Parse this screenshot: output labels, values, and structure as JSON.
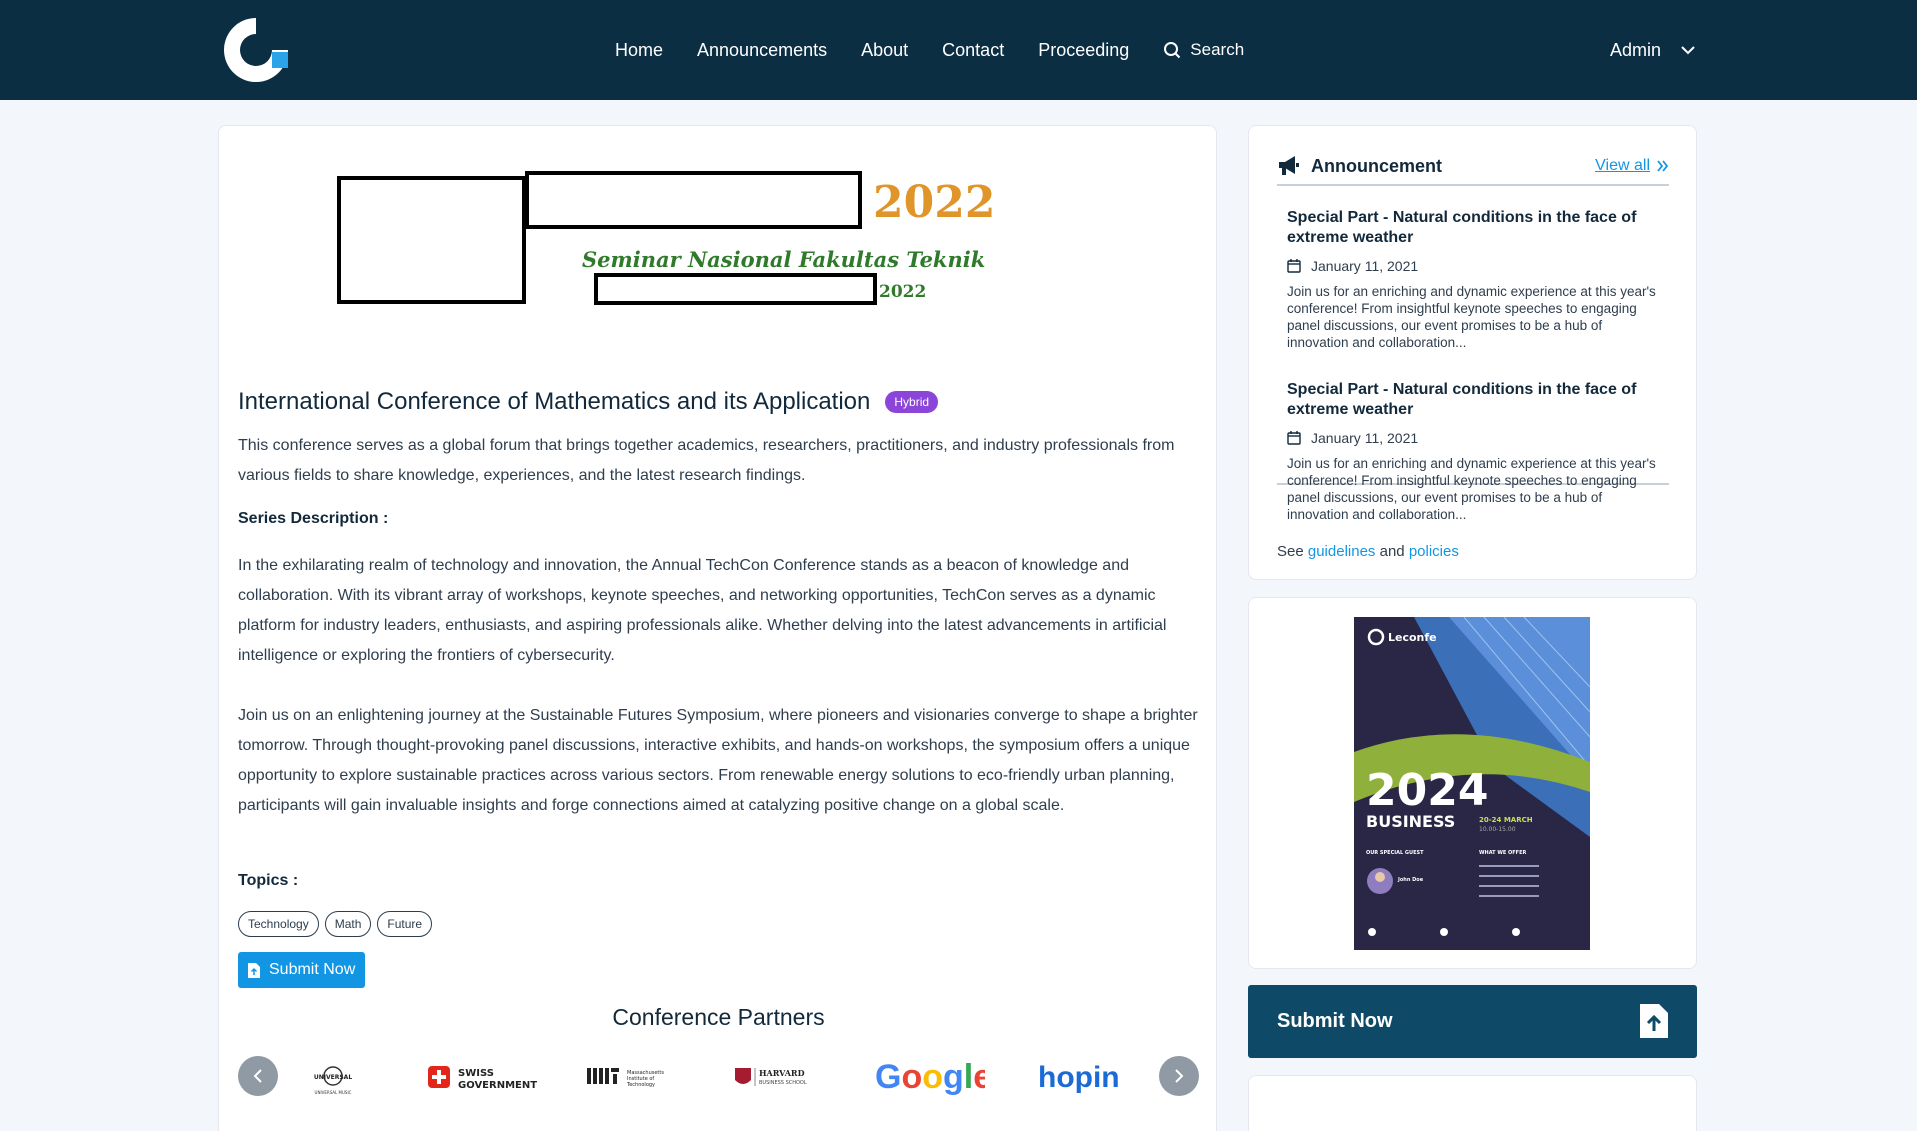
{
  "nav": {
    "items": [
      "Home",
      "Announcements",
      "About",
      "Contact",
      "Proceeding"
    ],
    "search_label": "Search",
    "user_label": "Admin"
  },
  "banner": {
    "year": "2022",
    "subtitle": "Seminar Nasional Fakultas Teknik",
    "sub_year": "2022"
  },
  "conference": {
    "title": "International Conference of Mathematics and its Application",
    "badge": "Hybrid",
    "intro": "This conference serves as a global forum that brings together academics, researchers, practitioners, and industry professionals from various fields to share knowledge, experiences, and the latest research findings.",
    "series_label": "Series Description :",
    "series_p1": "In the exhilarating realm of technology and innovation, the Annual TechCon Conference stands as a beacon of knowledge and collaboration. With its vibrant array of workshops, keynote speeches, and networking opportunities, TechCon serves as a dynamic platform for industry leaders, enthusiasts, and aspiring professionals alike. Whether delving into the latest advancements in artificial intelligence or exploring the frontiers of cybersecurity.",
    "series_p2": "Join us on an enlightening journey at the Sustainable Futures Symposium, where pioneers and visionaries converge to shape a brighter tomorrow. Through thought-provoking panel discussions, interactive exhibits, and hands-on workshops, the symposium offers a unique opportunity to explore sustainable practices across various sectors. From renewable energy solutions to eco-friendly urban planning, participants will gain invaluable insights and forge connections aimed at catalyzing positive change on a global scale.",
    "topics_label": "Topics :",
    "topics": [
      "Technology",
      "Math",
      "Future"
    ],
    "submit_label": "Submit Now"
  },
  "partners": {
    "title": "Conference Partners",
    "logos": [
      {
        "name": "UNIVERSAL",
        "sub": "UNIVERSAL MUSIC"
      },
      {
        "name": "SWISS",
        "sub": "GOVERNMENT"
      },
      {
        "name": "MIT",
        "sub": "Massachusetts Institute of Technology"
      },
      {
        "name": "HARVARD",
        "sub": "BUSINESS SCHOOL"
      },
      {
        "name": "Google"
      },
      {
        "name": "hopin"
      }
    ]
  },
  "announcements": {
    "title": "Announcement",
    "view_all": "View all",
    "items": [
      {
        "title": "Special Part - Natural conditions in the face of extreme weather",
        "date": "January 11, 2021",
        "desc": "Join us for an enriching and dynamic experience at this year's conference! From insightful keynote speeches to engaging panel discussions, our event promises to be a hub of innovation and collaboration..."
      },
      {
        "title": "Special Part - Natural conditions in the face of extreme weather",
        "date": "January 11, 2021",
        "desc": "Join us for an enriching and dynamic experience at this year's conference! From insightful keynote speeches to engaging panel discussions, our event promises to be a hub of innovation and collaboration..."
      }
    ],
    "see_prefix": "See",
    "guidelines": "guidelines",
    "and": "and",
    "policies": "policies"
  },
  "poster": {
    "brand": "Leconfe",
    "year": "2024",
    "headline": "BUSINESS",
    "dates": "20-24 MARCH",
    "time": "10.00-15.00",
    "guest_label": "OUR SPECIAL GUEST",
    "guest_name": "John Doe",
    "offer_label": "WHAT WE OFFER"
  },
  "sidebar_submit": "Submit Now",
  "colors": {
    "header": "#0b2e43",
    "accent": "#1296e3",
    "badge": "#8c45d9",
    "submit_dark": "#0e4a68"
  }
}
